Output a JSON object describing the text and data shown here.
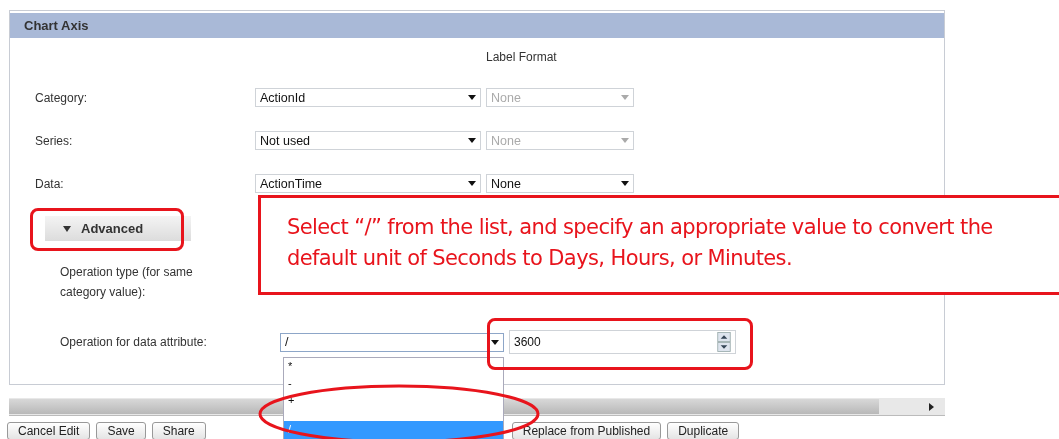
{
  "panel": {
    "title": "Chart Axis",
    "label_format_heading": "Label Format",
    "rows": [
      {
        "label": "Category:",
        "value": "ActionId",
        "format": "None",
        "format_disabled": true
      },
      {
        "label": "Series:",
        "value": "Not used",
        "format": "None",
        "format_disabled": true
      },
      {
        "label": "Data:",
        "value": "ActionTime",
        "format": "None",
        "format_disabled": false
      }
    ],
    "advanced": {
      "label": "Advanced",
      "expanded": true
    },
    "operation_type_label": "Operation type (for same category value):",
    "operation_data": {
      "label": "Operation for data attribute:",
      "value": "/",
      "number": "3600",
      "options": [
        {
          "label": "*",
          "selected": false
        },
        {
          "label": "-",
          "selected": false
        },
        {
          "label": "+",
          "selected": false
        },
        {
          "label": "/",
          "selected": true
        }
      ]
    }
  },
  "buttons": [
    "Cancel Edit",
    "Save",
    "Share",
    "Replace from Published",
    "Duplicate"
  ],
  "callout": "Select “/” from the list, and specify an appropriate value to convert the default unit of Seconds to Days, Hours, or Minutes."
}
